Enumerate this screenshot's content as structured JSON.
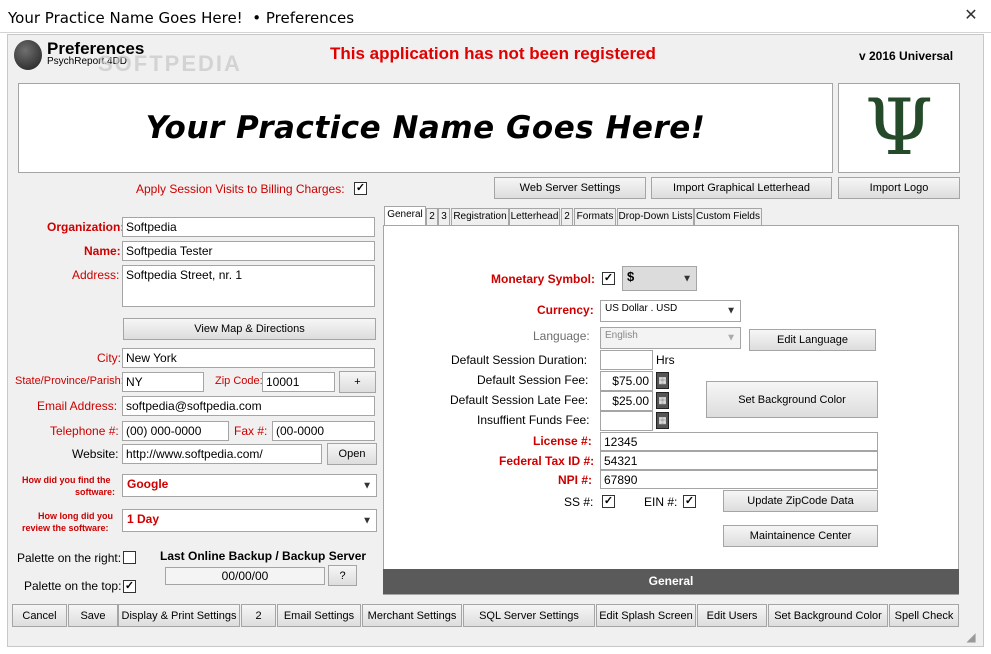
{
  "window": {
    "title": "Your Practice Name Goes Here!  • Preferences",
    "close": "✕"
  },
  "header": {
    "app_title": "Preferences",
    "app_subtitle": "PsychReport.4DD",
    "watermark": "SOFTPEDIA",
    "registration_notice": "This application has not been registered",
    "version": "v 2016 Universal"
  },
  "banner": {
    "practice_name": "Your Practice Name Goes Here!",
    "logo_glyph": "Ψ"
  },
  "left": {
    "apply_session_label": "Apply Session Visits to Billing Charges:",
    "apply_session_checked": "✓",
    "organization_label": "Organization:",
    "organization_value": "Softpedia",
    "name_label": "Name:",
    "name_value": "Softpedia Tester",
    "address_label": "Address:",
    "address_value": "Softpedia Street, nr. 1",
    "view_map_button": "View Map & Directions",
    "city_label": "City:",
    "city_value": "New York",
    "state_label": "State/Province/Parish:",
    "state_value": "NY",
    "zip_label": "Zip Code:",
    "zip_value": "10001",
    "zip_plus_button": "+",
    "email_label": "Email Address:",
    "email_value": "softpedia@softpedia.com",
    "telephone_label": "Telephone #:",
    "telephone_value": "(00) 000-0000",
    "fax_label": "Fax #:",
    "fax_value": "(00-0000",
    "website_label": "Website:",
    "website_value": "http://www.softpedia.com/",
    "open_button": "Open",
    "find_label_1": "How did you find the",
    "find_label_2": "software:",
    "find_value": "Google",
    "review_label_1": "How long did you",
    "review_label_2": "review the software:",
    "review_value": "1 Day",
    "palette_right_label": "Palette on the right:",
    "palette_right_checked": "",
    "palette_top_label": "Palette on the top:",
    "palette_top_checked": "✓",
    "backup_label": "Last Online Backup / Backup Server",
    "backup_value": "00/00/00",
    "backup_help_button": "?"
  },
  "top_buttons": {
    "web_server": "Web Server Settings",
    "import_letterhead": "Import Graphical Letterhead",
    "import_logo": "Import Logo"
  },
  "tabs": [
    {
      "label": "General",
      "active": true
    },
    {
      "label": "2"
    },
    {
      "label": "3"
    },
    {
      "label": "Registration"
    },
    {
      "label": "Letterhead"
    },
    {
      "label": "2"
    },
    {
      "label": "Formats"
    },
    {
      "label": "Drop-Down Lists"
    },
    {
      "label": "Custom Fields"
    }
  ],
  "general": {
    "monetary_symbol_label": "Monetary Symbol:",
    "monetary_symbol_checked": "✓",
    "monetary_symbol_value": "$",
    "currency_label": "Currency:",
    "currency_value": "US Dollar . USD",
    "language_label": "Language:",
    "language_value": "English",
    "edit_language_button": "Edit Language",
    "session_duration_label": "Default Session Duration:",
    "session_duration_value": "",
    "session_duration_unit": "Hrs",
    "session_fee_label": "Default Session Fee:",
    "session_fee_value": "$75.00",
    "late_fee_label": "Default Session Late Fee:",
    "late_fee_value": "$25.00",
    "insufficient_label": "Insuffient Funds Fee:",
    "insufficient_value": "",
    "set_bg_button": "Set Background Color",
    "license_label": "License #:",
    "license_value": "12345",
    "tax_label": "Federal Tax ID #:",
    "tax_value": "54321",
    "npi_label": "NPI #:",
    "npi_value": "67890",
    "ss_label": "SS #:",
    "ss_checked": "✓",
    "ein_label": "EIN #:",
    "ein_checked": "✓",
    "update_zip_button": "Update ZipCode Data",
    "maintenance_button": "Maintainence Center",
    "footer_label": "General"
  },
  "bottom_buttons": [
    "Cancel",
    "Save",
    "Display & Print Settings",
    "2",
    "Email Settings",
    "Merchant Settings",
    "SQL Server Settings",
    "Edit Splash Screen",
    "Edit Users",
    "Set Background Color",
    "Spell Check"
  ],
  "colors": {
    "label_red": "#cc0000",
    "title_red": "#e00000",
    "tab_footer": "#5a5a5a"
  }
}
